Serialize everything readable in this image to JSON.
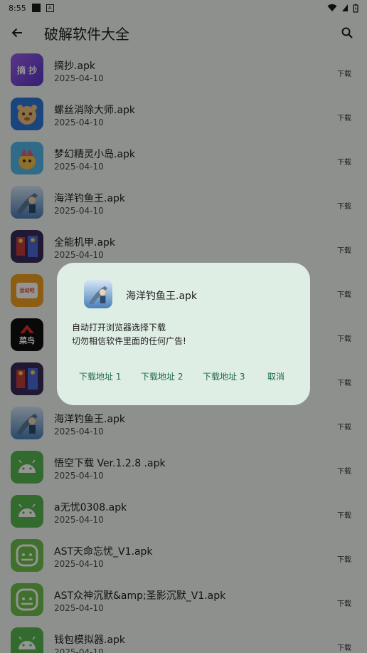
{
  "status_bar": {
    "time": "8:55",
    "notif_glyph": "A"
  },
  "app_bar": {
    "title": "破解软件大全"
  },
  "list": [
    {
      "name": "摘抄.apk",
      "date": "2025-04-10",
      "download": "下载",
      "icon": "zhaochao-icon"
    },
    {
      "name": "螺丝消除大师.apk",
      "date": "2025-04-10",
      "download": "下载",
      "icon": "screw-master-icon"
    },
    {
      "name": "梦幻精灵小岛.apk",
      "date": "2025-04-10",
      "download": "下载",
      "icon": "fairy-island-icon"
    },
    {
      "name": "海洋钓鱼王.apk",
      "date": "2025-04-10",
      "download": "下载",
      "icon": "fishing-king-icon"
    },
    {
      "name": "全能机甲.apk",
      "date": "2025-04-10",
      "download": "下载",
      "icon": "mecha-icon"
    },
    {
      "name": "",
      "date": "",
      "download": "下载",
      "icon": "tv-icon"
    },
    {
      "name": "",
      "date": "",
      "download": "下载",
      "icon": "cainiao-icon"
    },
    {
      "name": "",
      "date": "",
      "download": "下载",
      "icon": "mecha-icon"
    },
    {
      "name": "海洋钓鱼王.apk",
      "date": "2025-04-10",
      "download": "下载",
      "icon": "fishing-king-icon"
    },
    {
      "name": "悟空下载 Ver.1.2.8 .apk",
      "date": "2025-04-10",
      "download": "下载",
      "icon": "android-icon"
    },
    {
      "name": "a无忧0308.apk",
      "date": "2025-04-10",
      "download": "下载",
      "icon": "android-icon"
    },
    {
      "name": "AST天命忘忧_V1.apk",
      "date": "2025-04-10",
      "download": "下载",
      "icon": "android-icon"
    },
    {
      "name": "AST众神沉默&amp;圣影沉默_V1.apk",
      "date": "2025-04-10",
      "download": "下载",
      "icon": "android-icon"
    },
    {
      "name": "钱包模拟器.apk",
      "date": "2025-04-10",
      "download": "下载",
      "icon": "android-icon"
    }
  ],
  "icon_text": {
    "zhaochao": "摘 抄",
    "tv": "运动吧",
    "cainiao": "菜鸟"
  },
  "dialog": {
    "title": "海洋钓鱼王.apk",
    "message_line1": "自动打开浏览器选择下载",
    "message_line2": "切勿相信软件里面的任何广告!",
    "btn1": "下载地址 1",
    "btn2": "下载地址 2",
    "btn3": "下载地址 3",
    "cancel": "取消"
  },
  "colors": {
    "accent": "#1f6b48",
    "dialog_bg": "#dfeee5",
    "android_green": "#56b94f"
  }
}
